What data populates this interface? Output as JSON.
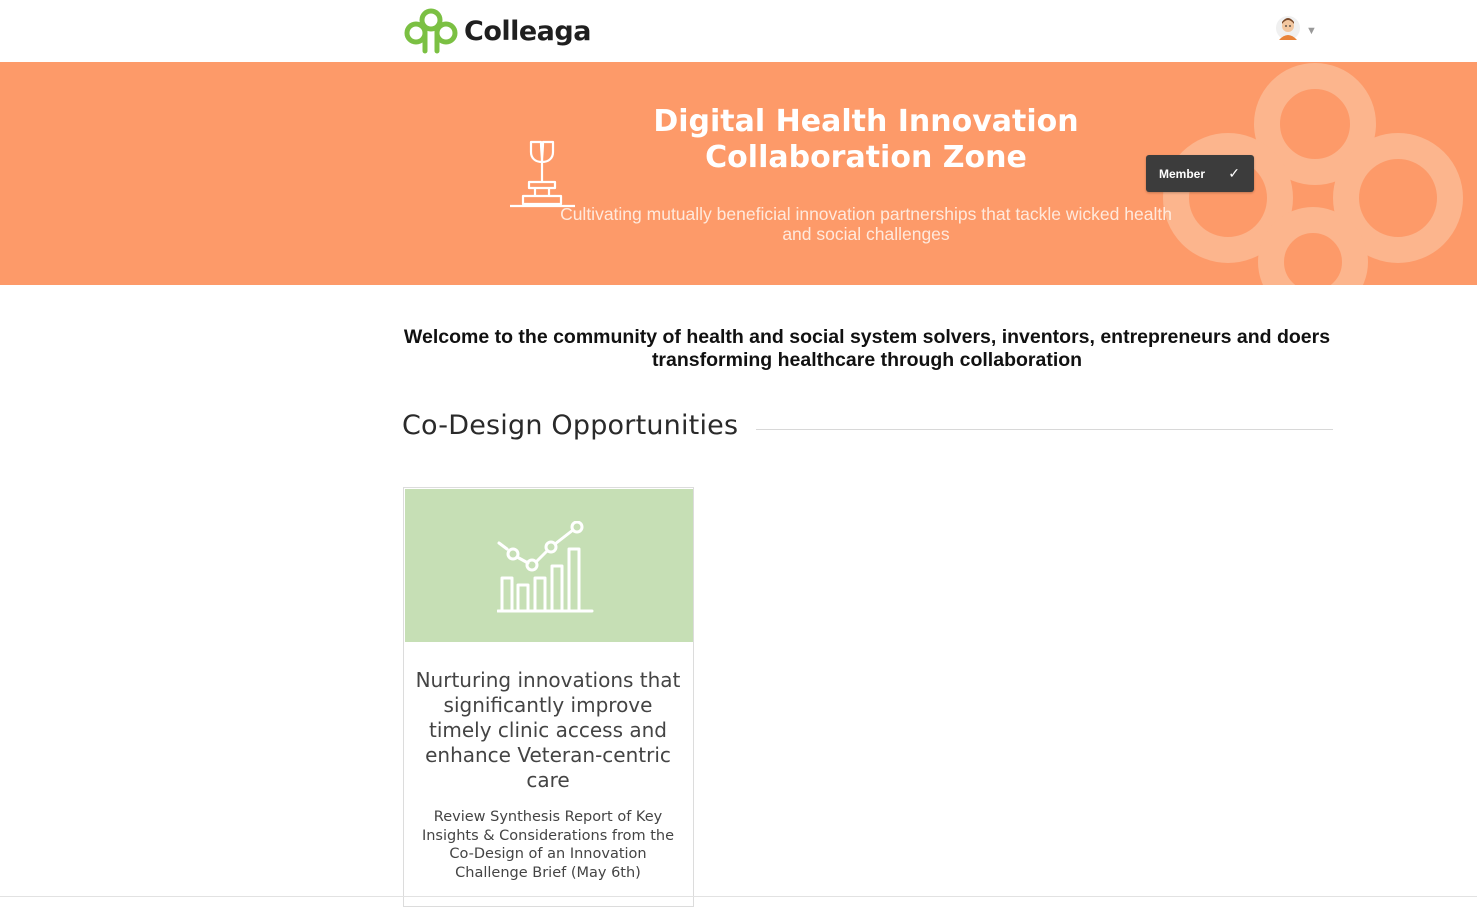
{
  "header": {
    "logo_text": "Colleaga",
    "logo_icon": "colleaga-trefoil-logo",
    "user_avatar_icon": "user-avatar",
    "user_menu_caret": "▼",
    "colors": {
      "logo_green": "#7bc043",
      "logo_text": "#1f1f1f"
    }
  },
  "banner": {
    "title": "Digital Health Innovation Collaboration Zone",
    "subtitle": "Cultivating mutually beneficial innovation partnerships that tackle wicked health and social challenges",
    "icon": "sprout-icon",
    "membership": {
      "label": "Member",
      "check": "✓"
    },
    "colors": {
      "background": "#fd9a69",
      "text": "#ffffff",
      "button_bg": "#3c3c3c"
    }
  },
  "main": {
    "welcome": "Welcome to the community of health and social system solvers, inventors, entrepreneurs and doers transforming healthcare through collaboration",
    "section_title": "Co-Design Opportunities",
    "cards": [
      {
        "icon": "growth-chart-icon",
        "title": "Nurturing innovations that significantly improve timely clinic access and enhance Veteran-centric care",
        "description": "Review Synthesis Report of Key Insights & Considerations from the Co-Design of an Innovation Challenge Brief (May 6th)",
        "colors": {
          "image_bg": "#c6dfb5"
        }
      }
    ]
  }
}
